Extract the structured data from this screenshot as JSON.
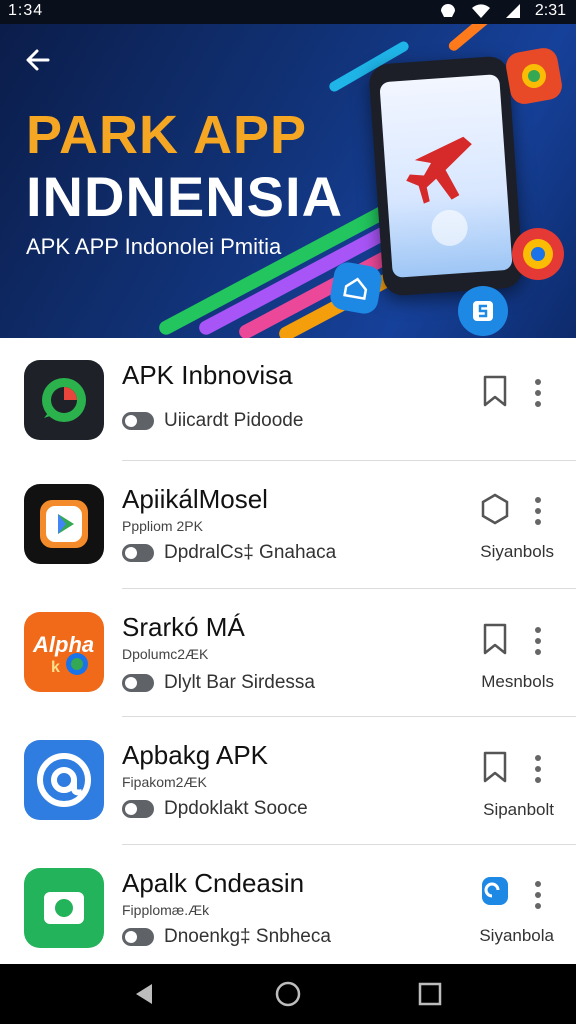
{
  "status": {
    "time": "1:34",
    "right_time": "2:31"
  },
  "hero": {
    "title_line1": "PARK APP",
    "title_line2": "INDNENSIA",
    "subtitle": "APK APP Indonolei Pmitia"
  },
  "apps": [
    {
      "name": "APK Inbnovisa",
      "meta": "",
      "developer": "Uiicardt Pidoode",
      "label": "",
      "bookmark": "bookmark",
      "icon": "green-chat-icon",
      "color": "#1e2127"
    },
    {
      "name": "ApiikálMosel",
      "meta": "Pppliom 2PK",
      "developer": "DpdralCs‡ Gnahaca",
      "label": "Siyanbols",
      "bookmark": "hexagon",
      "icon": "play-store-icon",
      "color": "#111"
    },
    {
      "name": "Srarkó MÁ",
      "meta": "Dpolumc2ÆK",
      "developer": "Dlylt Bar Sirdessa",
      "label": "Mesnbols",
      "bookmark": "bookmark",
      "icon": "orange-logo-icon",
      "color": "#f06a1a"
    },
    {
      "name": "Apbakg APK",
      "meta": "Fipakom2ÆK",
      "developer": "Dpdoklakt Sooce",
      "label": "Sipanbolt",
      "bookmark": "bookmark",
      "icon": "blue-at-icon",
      "color": "#2f7de1"
    },
    {
      "name": "Apalk Cndeasin",
      "meta": "Fipplomæ.Æk",
      "developer": "Dnoenkg‡ Snbheca",
      "label": "Siyanbola",
      "bookmark": "blue-badge",
      "icon": "camera-icon",
      "color": "#23b35a"
    }
  ]
}
